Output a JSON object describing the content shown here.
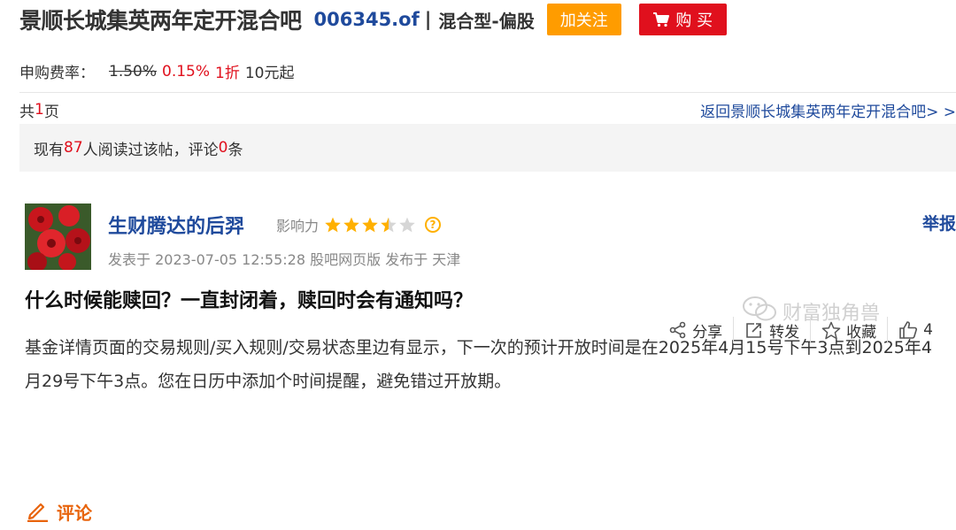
{
  "header": {
    "bar_name": "景顺长城集英两年定开混合吧",
    "fund_code": "006345.of",
    "separator": "|",
    "fund_type": "混合型-偏股",
    "follow_label": "加关注",
    "buy_label": "购 买"
  },
  "fee": {
    "label": "申购费率：",
    "old_rate": "1.50%",
    "new_rate": "0.15%",
    "discount": "1折",
    "minimum": "10元起"
  },
  "pager": {
    "prefix": "共",
    "pages": "1",
    "suffix": "页",
    "back_link": "返回景顺长城集英两年定开混合吧> >"
  },
  "stats": {
    "prefix": "现有",
    "readers": "87",
    "middle": "人阅读过该帖，评论",
    "comments": "0",
    "suffix": "条"
  },
  "post": {
    "author": "生财腾达的后羿",
    "influence_label": "影响力",
    "influence_stars": 3.5,
    "influence_max": 5,
    "report_label": "举报",
    "meta": "发表于 2023-07-05 12:55:28 股吧网页版 发布于 天津",
    "title": "什么时候能赎回？一直封闭着，赎回时会有通知吗？",
    "body": "基金详情页面的交易规则/买入规则/交易状态里边有显示，下一次的预计开放时间是在2025年4月15号下午3点到2025年4月29号下午3点。您在日历中添加个时间提醒，避免错过开放期。"
  },
  "actions": {
    "comment_label": "评论",
    "share_label": "分享",
    "repost_label": "转发",
    "favorite_label": "收藏",
    "like_count": "4"
  },
  "watermark": {
    "text": "财富独角兽"
  },
  "colors": {
    "brand_blue": "#1f4a9c",
    "accent_red": "#e0101d",
    "follow_orange": "#ff9c00",
    "comment_orange": "#e8640c",
    "star_gold": "#ffb000"
  }
}
